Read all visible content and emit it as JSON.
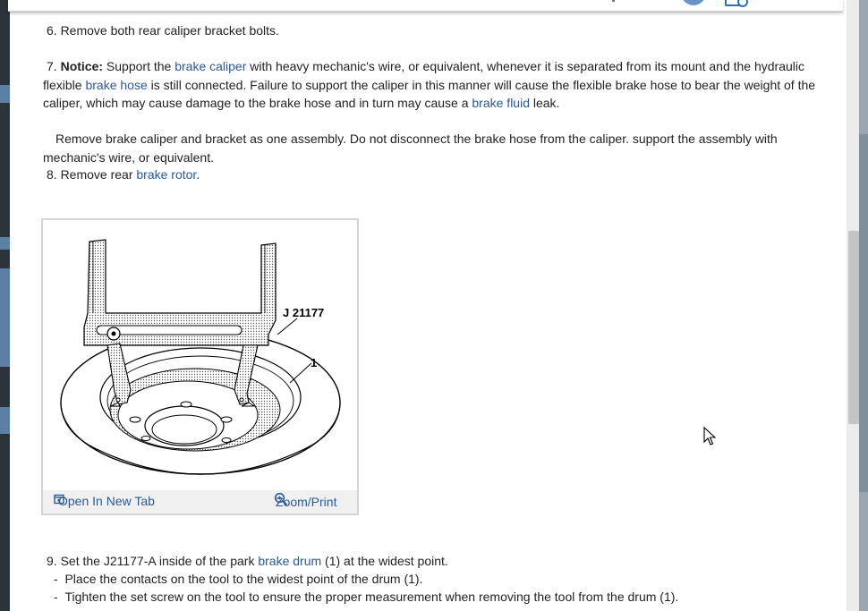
{
  "step6": {
    "text": "6. Remove both rear caliper bracket bolts."
  },
  "step7": {
    "number": "7.",
    "notice_label": "Notice:",
    "t1": " Support the ",
    "link1": "brake caliper",
    "t2": " with heavy mechanic's wire, or equivalent, whenever it is separated from its mount and the hydraulic flexible ",
    "link2": "brake hose",
    "t3": " is still connected. Failure to support the caliper in this manner will cause the flexible brake hose to bear the weight of the caliper, which may cause damage to the brake hose and in turn may cause a ",
    "link3": "brake fluid",
    "t4": " leak."
  },
  "remove_note": {
    "text": "Remove brake caliper and bracket as one assembly. Do not disconnect the brake hose from the caliper. support the assembly with mechanic's wire, or equivalent."
  },
  "step8": {
    "t1": "8. Remove rear ",
    "link": "brake rotor",
    "t2": "."
  },
  "figure": {
    "label_tool": "J 21177",
    "label_part": "1",
    "open_tab": "Open In New Tab",
    "zoom_print": "Zoom/Print",
    "open_icon": "open-new-tab-icon",
    "zoom_icon": "zoom-icon"
  },
  "step9": {
    "t1": "9. Set the J21177-A inside of the park ",
    "link": "brake drum",
    "t2": " (1) at the widest point.",
    "sub1": "Place the contacts on the tool to the widest point of the drum (1).",
    "sub2": "Tighten the set screw on the tool to ensure the proper measurement when removing the tool from the drum (1).",
    "bullet": "-"
  },
  "colors": {
    "link": "#2a5a9e",
    "accent": "#6a93c8"
  }
}
